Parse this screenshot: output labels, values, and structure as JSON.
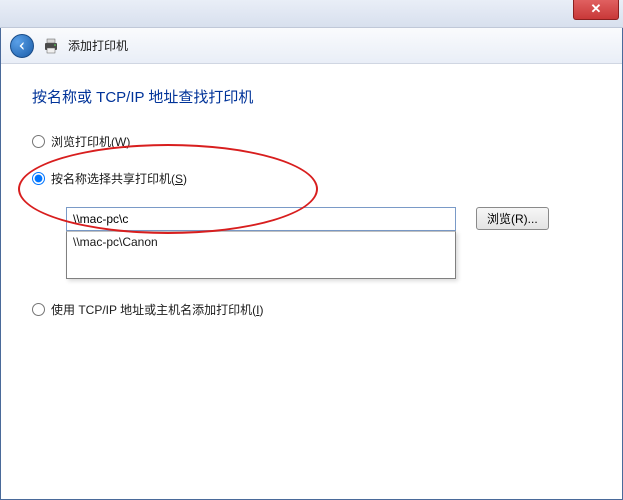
{
  "titlebar": {
    "close_glyph": "✕"
  },
  "header": {
    "title": "添加打印机"
  },
  "page": {
    "heading": "按名称或 TCP/IP 地址查找打印机"
  },
  "options": {
    "browse": {
      "label": "浏览打印机(",
      "hotkey": "W",
      "suffix": ")"
    },
    "by_name": {
      "label": "按名称选择共享打印机(",
      "hotkey": "S",
      "suffix": ")",
      "input_value": "\\\\mac-pc\\c",
      "browse_button": "浏览(R)...",
      "suggestion": "\\\\mac-pc\\Canon"
    },
    "by_tcpip": {
      "label": "使用 TCP/IP 地址或主机名添加打印机(",
      "hotkey": "I",
      "suffix": ")"
    }
  }
}
